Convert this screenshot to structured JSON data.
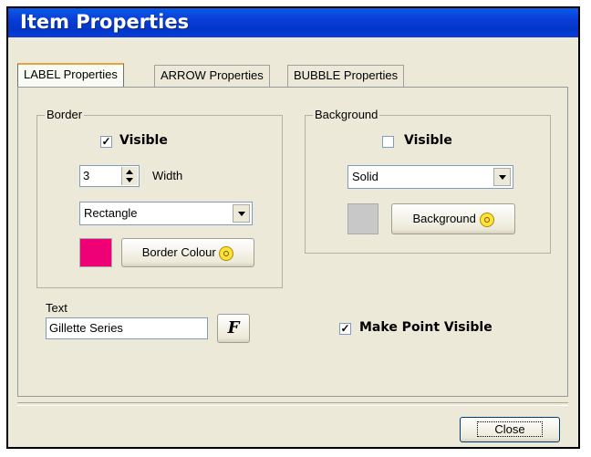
{
  "window": {
    "title": "Item Properties",
    "tabs": [
      {
        "label": "LABEL Properties"
      },
      {
        "label": "ARROW Properties"
      },
      {
        "label": "BUBBLE Properties"
      }
    ]
  },
  "border": {
    "group_label": "Border",
    "visible_label": "Visible",
    "visible_checked": true,
    "width_value": "3",
    "width_label": "Width",
    "shape_value": "Rectangle",
    "colour_button": "Border Colour",
    "colour": "#ee0077"
  },
  "background": {
    "group_label": "Background",
    "visible_label": "Visible",
    "visible_checked": false,
    "fill_value": "Solid",
    "colour_button": "Background",
    "colour": "#c8c8c8"
  },
  "text": {
    "label": "Text",
    "value": "Gillette Series",
    "font_button": "F"
  },
  "make_point_visible": {
    "label": "Make Point Visible",
    "checked": true
  },
  "close_button": "Close"
}
